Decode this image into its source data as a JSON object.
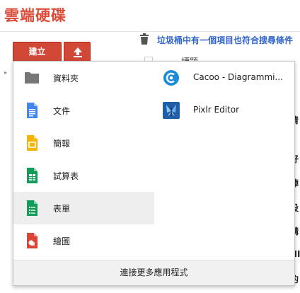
{
  "header": {
    "title": "雲端硬碟"
  },
  "toolbar": {
    "create_label": "建立",
    "upload_icon": "upload-icon"
  },
  "notice": {
    "text": "垃圾桶中有一個項目也符合搜尋條件",
    "icon": "trash-icon"
  },
  "background": {
    "column_header": "標題",
    "row_fragments": [
      "清",
      "好",
      "陣",
      "設",
      "講",
      "HI",
      "的",
      "行"
    ]
  },
  "create_menu": {
    "left_items": [
      {
        "label": "資料夾",
        "icon": "folder-icon",
        "color": "#777777"
      },
      {
        "label": "文件",
        "icon": "docs-icon",
        "color": "#4285f4"
      },
      {
        "label": "簡報",
        "icon": "slides-icon",
        "color": "#f4b400"
      },
      {
        "label": "試算表",
        "icon": "sheets-icon",
        "color": "#0f9d58"
      },
      {
        "label": "表單",
        "icon": "forms-icon",
        "color": "#0f9d58"
      },
      {
        "label": "繪圖",
        "icon": "drawings-icon",
        "color": "#db4437"
      }
    ],
    "right_items": [
      {
        "label": "Cacoo - Diagrammi...",
        "icon": "cacoo-icon",
        "color": "#1a8cd8"
      },
      {
        "label": "Pixlr Editor",
        "icon": "pixlr-icon",
        "color": "#1e5fa8"
      }
    ],
    "highlighted": "表單",
    "footer": "連接更多應用程式"
  }
}
